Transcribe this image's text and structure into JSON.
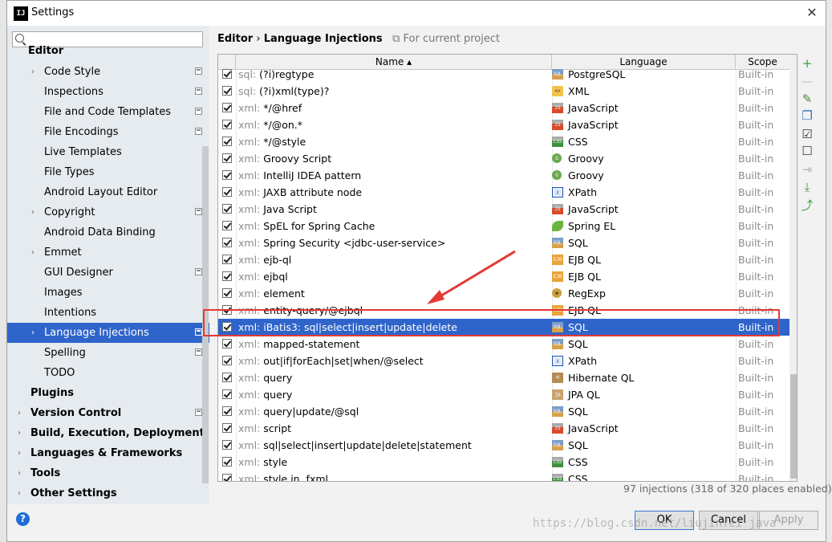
{
  "window": {
    "title": "Settings",
    "app_icon": "IJ"
  },
  "search": {
    "placeholder": ""
  },
  "sidebar": {
    "section": "Editor",
    "items": [
      {
        "label": "Code Style",
        "arrow": "›",
        "project": true
      },
      {
        "label": "Inspections",
        "arrow": "",
        "project": true
      },
      {
        "label": "File and Code Templates",
        "arrow": "",
        "project": true
      },
      {
        "label": "File Encodings",
        "arrow": "",
        "project": true
      },
      {
        "label": "Live Templates",
        "arrow": "",
        "project": false
      },
      {
        "label": "File Types",
        "arrow": "",
        "project": false
      },
      {
        "label": "Android Layout Editor",
        "arrow": "",
        "project": false
      },
      {
        "label": "Copyright",
        "arrow": "›",
        "project": true
      },
      {
        "label": "Android Data Binding",
        "arrow": "",
        "project": false
      },
      {
        "label": "Emmet",
        "arrow": "›",
        "project": false
      },
      {
        "label": "GUI Designer",
        "arrow": "",
        "project": true
      },
      {
        "label": "Images",
        "arrow": "",
        "project": false
      },
      {
        "label": "Intentions",
        "arrow": "",
        "project": false
      },
      {
        "label": "Language Injections",
        "arrow": "›",
        "project": true,
        "selected": true
      },
      {
        "label": "Spelling",
        "arrow": "",
        "project": true
      },
      {
        "label": "TODO",
        "arrow": "",
        "project": false
      }
    ],
    "top_items": [
      {
        "label": "Plugins",
        "arrow": "",
        "project": false
      },
      {
        "label": "Version Control",
        "arrow": "›",
        "project": true
      },
      {
        "label": "Build, Execution, Deployment",
        "arrow": "›",
        "project": false
      },
      {
        "label": "Languages & Frameworks",
        "arrow": "›",
        "project": false
      },
      {
        "label": "Tools",
        "arrow": "›",
        "project": false
      },
      {
        "label": "Other Settings",
        "arrow": "›",
        "project": false
      }
    ]
  },
  "breadcrumb": {
    "parent": "Editor",
    "separator": "›",
    "current": "Language Injections",
    "hint": "For current project"
  },
  "table": {
    "columns": {
      "name": "Name ▴",
      "language": "Language",
      "scope": "Scope"
    },
    "rows": [
      {
        "prefix": "sql:",
        "name": "(?i)regtype",
        "lang": "PostgreSQL",
        "icon": "sql",
        "scope": "Built-in"
      },
      {
        "prefix": "sql:",
        "name": "(?i)xml(type)?",
        "lang": "XML",
        "icon": "xml",
        "scope": "Built-in"
      },
      {
        "prefix": "xml:",
        "name": "*/@href",
        "lang": "JavaScript",
        "icon": "js",
        "scope": "Built-in"
      },
      {
        "prefix": "xml:",
        "name": "*/@on.*",
        "lang": "JavaScript",
        "icon": "js",
        "scope": "Built-in"
      },
      {
        "prefix": "xml:",
        "name": "*/@style",
        "lang": "CSS",
        "icon": "css",
        "scope": "Built-in"
      },
      {
        "prefix": "xml:",
        "name": "Groovy Script",
        "lang": "Groovy",
        "icon": "groovy",
        "scope": "Built-in"
      },
      {
        "prefix": "xml:",
        "name": "IntelliJ IDEA pattern",
        "lang": "Groovy",
        "icon": "groovy",
        "scope": "Built-in"
      },
      {
        "prefix": "xml:",
        "name": "JAXB attribute node",
        "lang": "XPath",
        "icon": "xpath",
        "scope": "Built-in"
      },
      {
        "prefix": "xml:",
        "name": "Java Script",
        "lang": "JavaScript",
        "icon": "js",
        "scope": "Built-in"
      },
      {
        "prefix": "xml:",
        "name": "SpEL for Spring Cache",
        "lang": "Spring EL",
        "icon": "spring",
        "scope": "Built-in"
      },
      {
        "prefix": "xml:",
        "name": "Spring Security <jdbc-user-service>",
        "lang": "SQL",
        "icon": "sql",
        "scope": "Built-in"
      },
      {
        "prefix": "xml:",
        "name": "ejb-ql",
        "lang": "EJB QL",
        "icon": "ejb",
        "scope": "Built-in"
      },
      {
        "prefix": "xml:",
        "name": "ejbql",
        "lang": "EJB QL",
        "icon": "ejb",
        "scope": "Built-in"
      },
      {
        "prefix": "xml:",
        "name": "element",
        "lang": "RegExp",
        "icon": "regexp",
        "scope": "Built-in"
      },
      {
        "prefix": "xml:",
        "name": "entity-query/@ejbql",
        "lang": "EJB QL",
        "icon": "ejb",
        "scope": "Built-in"
      },
      {
        "prefix": "xml:",
        "name": "iBatis3: sql|select|insert|update|delete",
        "lang": "SQL",
        "icon": "sql",
        "scope": "Built-in",
        "selected": true
      },
      {
        "prefix": "xml:",
        "name": "mapped-statement",
        "lang": "SQL",
        "icon": "sql",
        "scope": "Built-in"
      },
      {
        "prefix": "xml:",
        "name": "out|if|forEach|set|when/@select",
        "lang": "XPath",
        "icon": "xpath",
        "scope": "Built-in"
      },
      {
        "prefix": "xml:",
        "name": "query",
        "lang": "Hibernate QL",
        "icon": "hql",
        "scope": "Built-in"
      },
      {
        "prefix": "xml:",
        "name": "query",
        "lang": "JPA QL",
        "icon": "jpa",
        "scope": "Built-in"
      },
      {
        "prefix": "xml:",
        "name": "query|update/@sql",
        "lang": "SQL",
        "icon": "sql",
        "scope": "Built-in"
      },
      {
        "prefix": "xml:",
        "name": "script",
        "lang": "JavaScript",
        "icon": "js",
        "scope": "Built-in"
      },
      {
        "prefix": "xml:",
        "name": "sql|select|insert|update|delete|statement",
        "lang": "SQL",
        "icon": "sql",
        "scope": "Built-in"
      },
      {
        "prefix": "xml:",
        "name": "style",
        "lang": "CSS",
        "icon": "css",
        "scope": "Built-in"
      },
      {
        "prefix": "xml:",
        "name": "style in .fxml",
        "lang": "CSS",
        "icon": "css",
        "scope": "Built-in"
      }
    ]
  },
  "icon_glyphs": {
    "sql": "SQL",
    "js": "JS",
    "css": "CSS",
    "xml": "<>",
    "groovy": "G",
    "xpath": "X",
    "spring": "",
    "ejb": "EJB",
    "regexp": "✻",
    "hql": "H",
    "jpa": "jp"
  },
  "toolbar": [
    {
      "name": "add-icon",
      "glyph": "+",
      "color": "#3c9b3c"
    },
    {
      "name": "remove-icon",
      "glyph": "—",
      "color": "#c0c0c0"
    },
    {
      "name": "edit-icon",
      "glyph": "✎",
      "color": "#4a8a3a"
    },
    {
      "name": "copy-icon",
      "glyph": "❐",
      "color": "#2d6fc4"
    },
    {
      "name": "check-all-icon",
      "glyph": "☑",
      "color": "#333333"
    },
    {
      "name": "uncheck-all-icon",
      "glyph": "☐",
      "color": "#333333"
    },
    {
      "name": "import-disabled-icon",
      "glyph": "⇥",
      "color": "#b9b9b9"
    },
    {
      "name": "import-icon",
      "glyph": "⤓",
      "color": "#3c9b3c"
    },
    {
      "name": "export-icon",
      "glyph": "⤴",
      "color": "#3c9b3c"
    }
  ],
  "summary": "97 injections (318 of 320 places enabled)",
  "buttons": {
    "ok": "OK",
    "cancel": "Cancel",
    "apply": "Apply"
  },
  "help": "?",
  "watermark": "https://blog.csdn.net/liujinfei_java",
  "colors": {
    "selection": "#2f65ca",
    "highlight": "#e53935"
  }
}
